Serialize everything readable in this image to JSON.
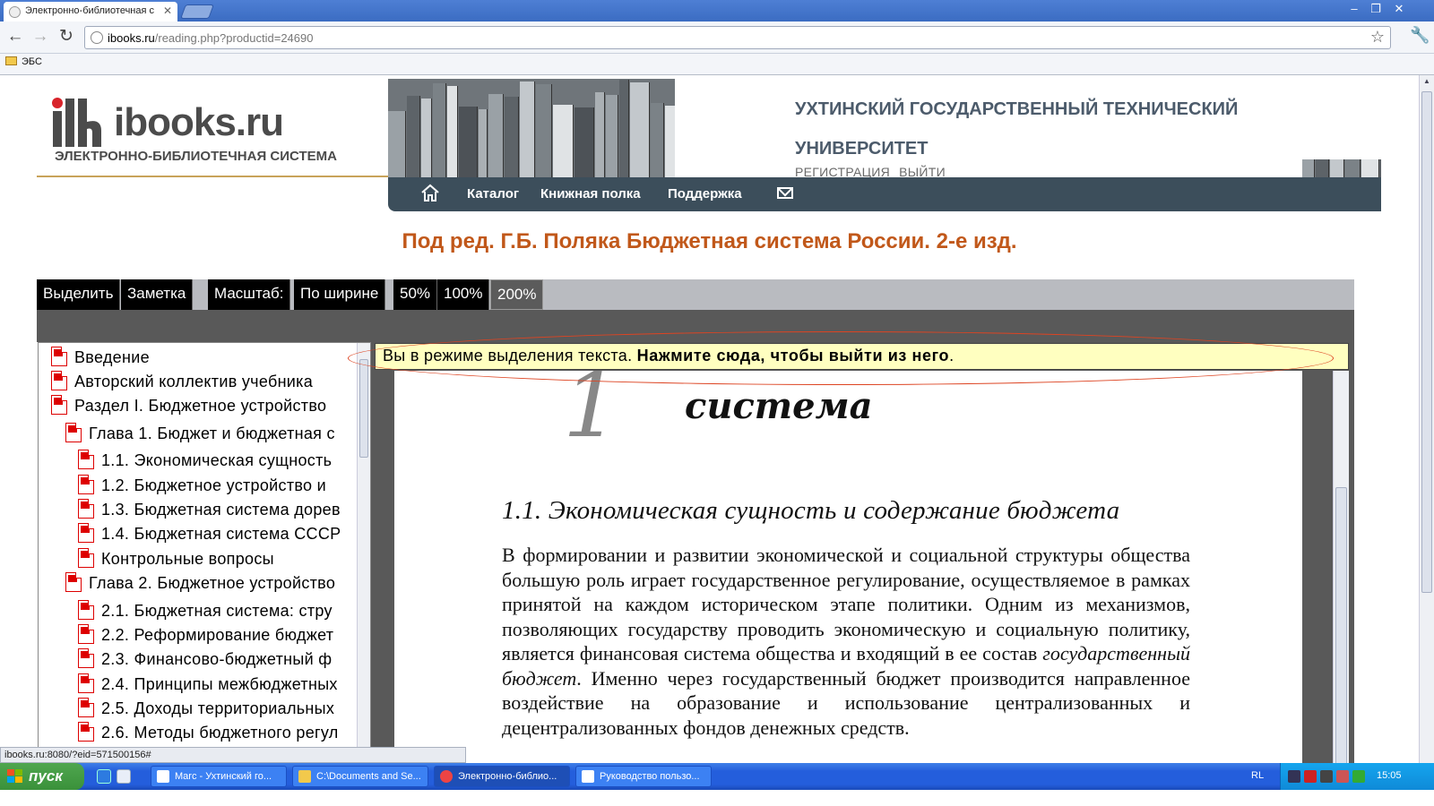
{
  "browser": {
    "tabs": [
      {
        "title": "Электронно-библиотечная с"
      }
    ],
    "url_host": "ibooks.ru",
    "url_path": "/reading.php?productid=24690",
    "bookmarks": [
      "ЭБС"
    ]
  },
  "site": {
    "logo_name": "ibooks.ru",
    "logo_sub": "ЭЛЕКТРОННО-БИБЛИОТЕЧНАЯ СИСТЕМА",
    "university_line1": "УХТИНСКИЙ ГОСУДАРСТВЕННЫЙ ТЕХНИЧЕСКИЙ",
    "university_line2": "УНИВЕРСИТЕТ",
    "auth_links": [
      "РЕГИСТРАЦИЯ",
      "ВЫЙТИ"
    ],
    "nav": [
      "Каталог",
      "Книжная полка",
      "Поддержка"
    ]
  },
  "book_title": "Под ред. Г.Б. Поляка Бюджетная система России. 2-е изд.",
  "reader_toolbar": {
    "select": "Выделить",
    "note": "Заметка",
    "scale_label": "Масштаб:",
    "fit_width": "По ширине",
    "zoom_levels": [
      "50%",
      "100%",
      "200%"
    ],
    "active_zoom": "200%"
  },
  "toc": [
    {
      "label": "Введение",
      "level": 0
    },
    {
      "label": "Авторский коллектив учебника",
      "level": 0
    },
    {
      "label": "Раздел I. Бюджетное устройство",
      "level": 0
    },
    {
      "label": "Глава 1. Бюджет и бюджетная с",
      "level": 1
    },
    {
      "label": "1.1. Экономическая сущность",
      "level": 2
    },
    {
      "label": "1.2. Бюджетное устройство и",
      "level": 2
    },
    {
      "label": "1.3. Бюджетная система дорев",
      "level": 2
    },
    {
      "label": "1.4. Бюджетная система СССР",
      "level": 2
    },
    {
      "label": "Контрольные вопросы",
      "level": 2
    },
    {
      "label": "Глава 2. Бюджетное устройство",
      "level": 1
    },
    {
      "label": "2.1. Бюджетная система: стру",
      "level": 2
    },
    {
      "label": "2.2. Реформирование бюджет",
      "level": 2
    },
    {
      "label": "2.3. Финансово-бюджетный ф",
      "level": 2
    },
    {
      "label": "2.4. Принципы межбюджетных",
      "level": 2
    },
    {
      "label": "2.5. Доходы территориальных",
      "level": 2
    },
    {
      "label": "2.6. Методы бюджетного регул",
      "level": 2
    }
  ],
  "notice": {
    "text": "Вы в режиме выделения текста. ",
    "action": "Нажмите сюда, чтобы выйти из него",
    "tail": "."
  },
  "page": {
    "chapter_num": "1",
    "chapter_word": "система",
    "section_title": "1.1. Экономическая сущность и содержание бюджета",
    "body_before_italic": "В формировании и развитии экономической и социальной структуры общества большую роль играет государственное регулирование, осуществляемое в рамках принятой на каждом историческом этапе политики. Одним из механизмов, позволяющих государству проводить экономическую и социальную политику, является финансовая система общества и входящий в ее состав ",
    "body_italic": "государственный бюджет",
    "body_after_italic": ". Именно через государственный бюджет производится направленное воздействие на образование и использование централизованных и децентрализованных фондов денежных средств."
  },
  "status_url": "ibooks.ru:8080/?eid=571500156#",
  "taskbar": {
    "start": "пуск",
    "tasks": [
      {
        "label": "Marc - Ухтинский го..."
      },
      {
        "label": "C:\\Documents and Se..."
      },
      {
        "label": "Электронно-библио..."
      },
      {
        "label": "Руководство пользо..."
      }
    ],
    "lang": "RL",
    "clock": "15:05"
  },
  "colors": {
    "title_orange": "#c1581a",
    "nav_bg": "#3c4e5b",
    "notice_bg": "#ffffc0"
  }
}
